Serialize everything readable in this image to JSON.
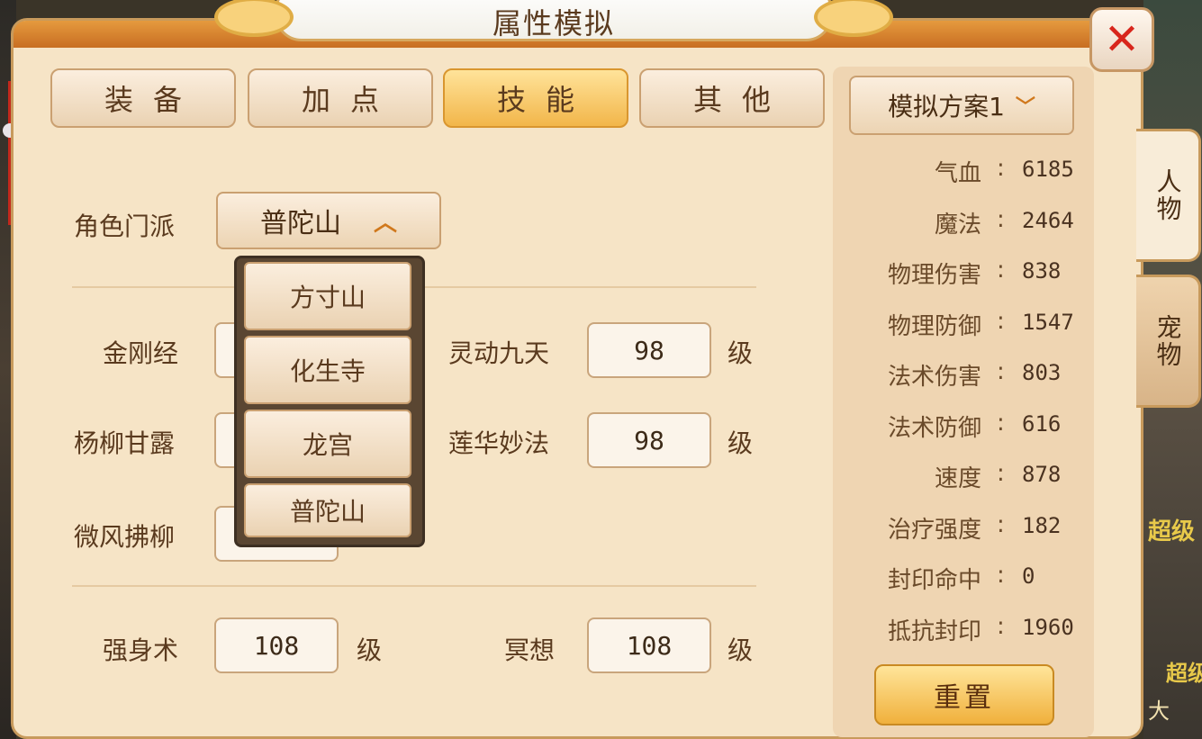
{
  "window": {
    "title": "属性模拟",
    "close_icon": "close-icon"
  },
  "tabs": [
    {
      "label": "装备",
      "active": false
    },
    {
      "label": "加点",
      "active": false
    },
    {
      "label": "技能",
      "active": true
    },
    {
      "label": "其他",
      "active": false
    }
  ],
  "sect": {
    "label": "角色门派",
    "value": "普陀山"
  },
  "sect_options": [
    "方寸山",
    "化生寺",
    "龙宫",
    "普陀山"
  ],
  "skills": {
    "left": [
      {
        "label": "金刚经",
        "value": ""
      },
      {
        "label": "杨柳甘露",
        "value": ""
      },
      {
        "label": "微风拂柳",
        "value": ""
      }
    ],
    "right": [
      {
        "label": "灵动九天",
        "value": "98",
        "unit": "级"
      },
      {
        "label": "莲华妙法",
        "value": "98",
        "unit": "级"
      }
    ]
  },
  "aux": [
    {
      "label": "强身术",
      "value": "108",
      "unit": "级"
    },
    {
      "label": "冥想",
      "value": "108",
      "unit": "级"
    }
  ],
  "plan": {
    "label": "模拟方案1"
  },
  "attributes": [
    {
      "name": "气血",
      "value": "6185"
    },
    {
      "name": "魔法",
      "value": "2464"
    },
    {
      "name": "物理伤害",
      "value": "838"
    },
    {
      "name": "物理防御",
      "value": "1547"
    },
    {
      "name": "法术伤害",
      "value": "803"
    },
    {
      "name": "法术防御",
      "value": "616"
    },
    {
      "name": "速度",
      "value": "878"
    },
    {
      "name": "治疗强度",
      "value": "182"
    },
    {
      "name": "封印命中",
      "value": "0"
    },
    {
      "name": "抵抗封印",
      "value": "1960"
    }
  ],
  "reset_label": "重置",
  "side_tabs": [
    {
      "label": "人物",
      "active": true
    },
    {
      "label": "宠物",
      "active": false
    }
  ],
  "background": {
    "text1": "超级",
    "text2": "超级",
    "text3": "大"
  },
  "colors": {
    "panel": "#f6e4c6",
    "active_tab": "#f2b64a",
    "close": "#d8261c",
    "accent": "#d0781c"
  }
}
